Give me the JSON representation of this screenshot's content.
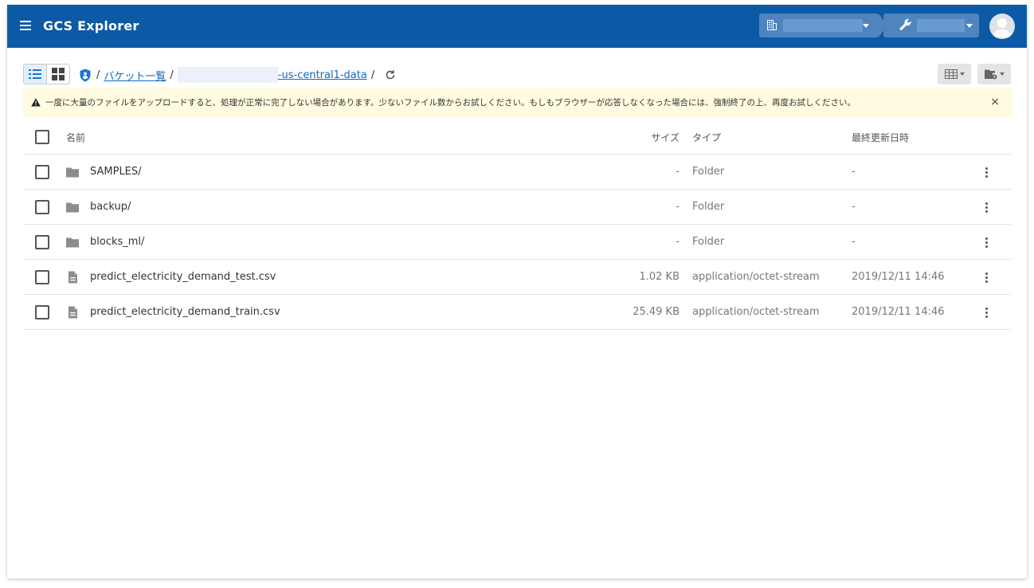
{
  "app": {
    "title": "GCS Explorer"
  },
  "breadcrumb": {
    "sep": "/",
    "bucket_list": "バケット一覧",
    "bucket_suffix": "-us-central1-data"
  },
  "alert": {
    "message": "一度に大量のファイルをアップロードすると、処理が正常に完了しない場合があります。少ないファイル数からお試しください。もしもブラウザーが応答しなくなった場合には、強制終了の上、再度お試しください。",
    "close": "×"
  },
  "table": {
    "headers": {
      "name": "名前",
      "size": "サイズ",
      "type": "タイプ",
      "updated": "最終更新日時"
    },
    "rows": [
      {
        "kind": "folder",
        "name": "SAMPLES/",
        "size": "-",
        "type": "Folder",
        "updated": "-"
      },
      {
        "kind": "folder",
        "name": "backup/",
        "size": "-",
        "type": "Folder",
        "updated": "-"
      },
      {
        "kind": "folder",
        "name": "blocks_ml/",
        "size": "-",
        "type": "Folder",
        "updated": "-"
      },
      {
        "kind": "file",
        "name": "predict_electricity_demand_test.csv",
        "size": "1.02 KB",
        "type": "application/octet-stream",
        "updated": "2019/12/11 14:46"
      },
      {
        "kind": "file",
        "name": "predict_electricity_demand_train.csv",
        "size": "25.49 KB",
        "type": "application/octet-stream",
        "updated": "2019/12/11 14:46"
      }
    ]
  },
  "icons": {
    "menu": "menu-icon",
    "organization": "building-icon",
    "project": "wrench-icon",
    "list_view": "list-view-icon",
    "grid_view": "grid-view-icon",
    "security": "shield-user-icon",
    "refresh": "refresh-icon",
    "columns": "table-columns-icon",
    "folder_settings": "folder-settings-icon",
    "warning": "warning-icon",
    "folder": "folder-icon",
    "file": "file-icon",
    "more": "more-vert-icon"
  },
  "colors": {
    "appbar": "#0c5aa6",
    "link": "#1565c0",
    "alert_bg": "#fffbe0"
  }
}
